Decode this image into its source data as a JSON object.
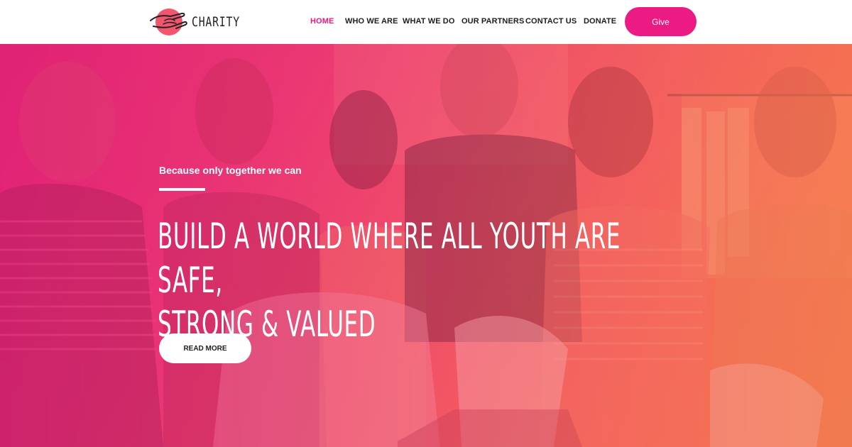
{
  "brand": {
    "name": "CHARITY",
    "logo_icon": "hands-heart-icon",
    "accent_color": "#ec1b84"
  },
  "nav": {
    "items": [
      {
        "label": "HOME",
        "active": true
      },
      {
        "label": "WHO WE ARE",
        "active": false
      },
      {
        "label": "WHAT WE DO",
        "active": false
      },
      {
        "label": "OUR PARTNERS",
        "active": false
      },
      {
        "label": "CONTACT US",
        "active": false
      },
      {
        "label": "DONATE",
        "active": false
      }
    ],
    "give_label": "Give"
  },
  "hero": {
    "tagline": "Because only together we can",
    "headline_line1": "BUILD A WORLD WHERE ALL YOUTH ARE SAFE,",
    "headline_line2": "STRONG & VALUED",
    "cta_label": "READ MORE",
    "photo": "group-of-volunteers-photo"
  }
}
